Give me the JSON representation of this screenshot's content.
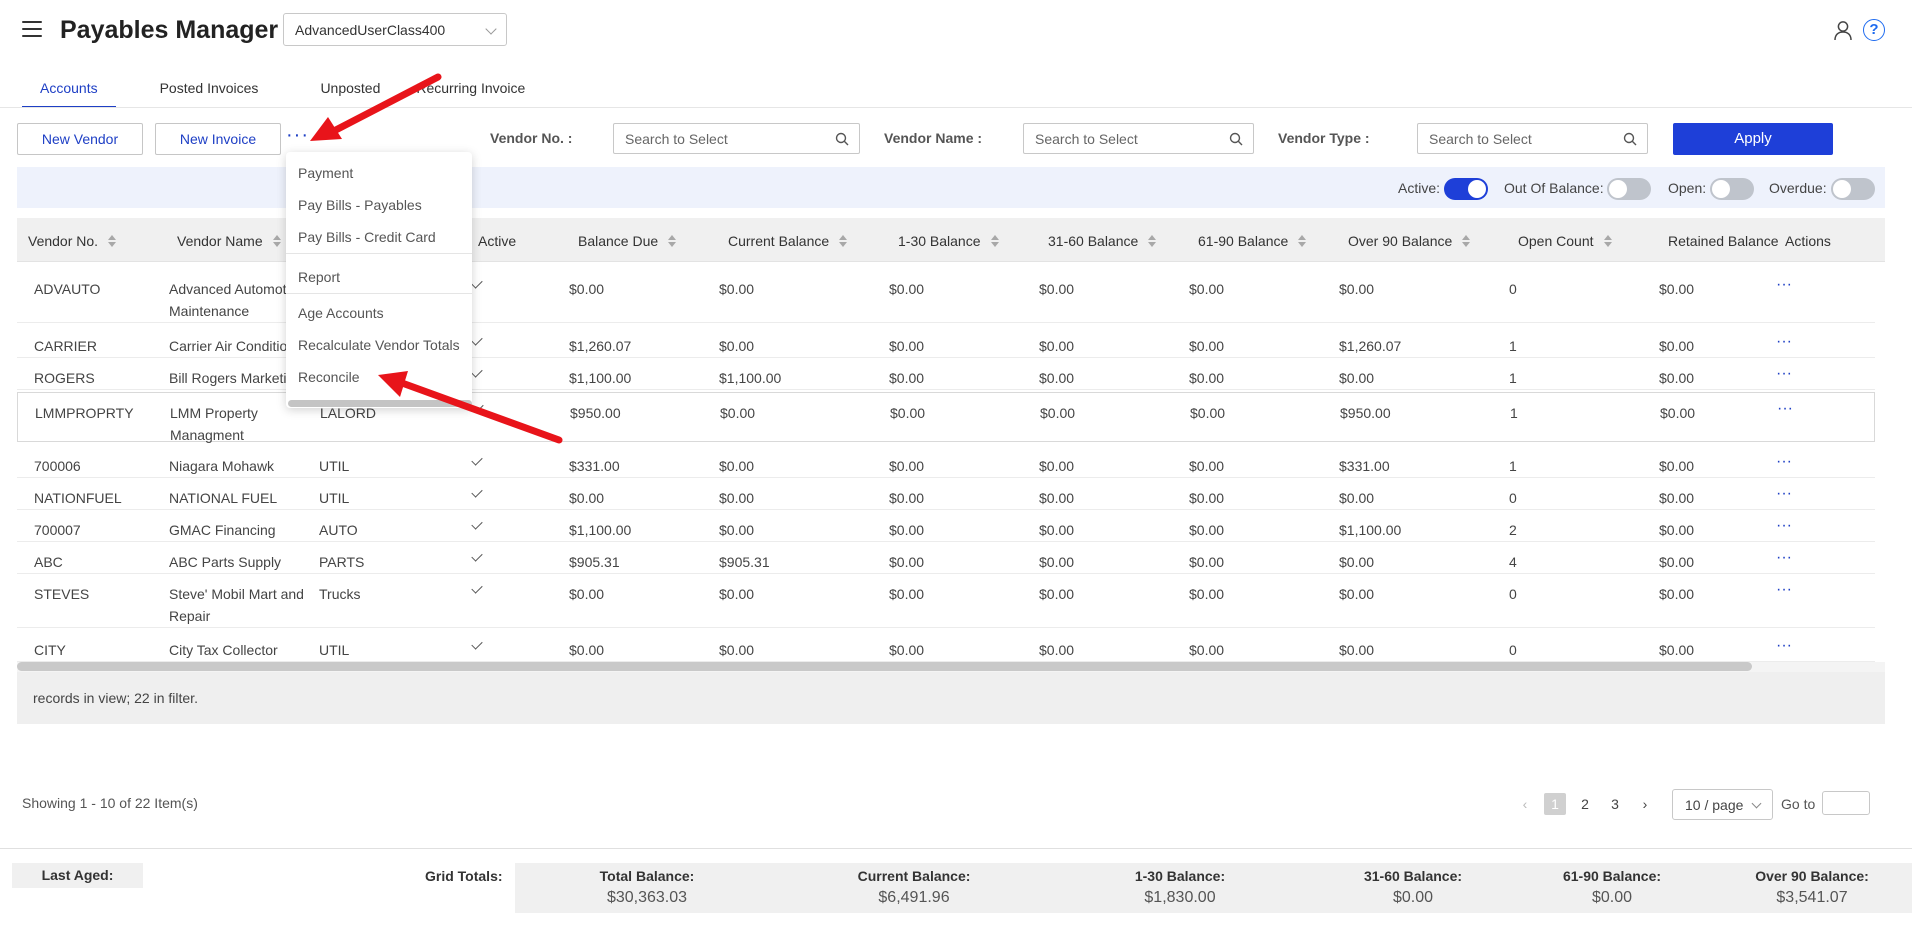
{
  "header": {
    "title": "Payables Manager",
    "class_select": "AdvancedUserClass400",
    "help_glyph": "?",
    "icons": {
      "menu": "hamburger-icon",
      "user": "user-icon",
      "help": "help-icon"
    }
  },
  "tabs": [
    {
      "label": "Accounts",
      "active": true
    },
    {
      "label": "Posted Invoices",
      "active": false
    },
    {
      "label": "Unposted",
      "active": false
    },
    {
      "label": "Recurring Invoice",
      "active": false
    }
  ],
  "toolbar": {
    "new_vendor": "New Vendor",
    "new_invoice": "New Invoice",
    "more": "···",
    "vendor_no_label": "Vendor No. :",
    "vendor_no_placeholder": "Search to Select",
    "vendor_name_label": "Vendor Name :",
    "vendor_name_placeholder": "Search to Select",
    "vendor_type_label": "Vendor Type :",
    "vendor_type_placeholder": "Search to Select",
    "apply": "Apply"
  },
  "toggles": [
    {
      "label": "Active:",
      "on": true
    },
    {
      "label": "Out Of Balance:",
      "on": false
    },
    {
      "label": "Open:",
      "on": false
    },
    {
      "label": "Overdue:",
      "on": false
    }
  ],
  "columns": [
    "Vendor No.",
    "Vendor Name",
    "Active",
    "Balance Due",
    "Current Balance",
    "1-30 Balance",
    "31-60 Balance",
    "61-90 Balance",
    "Over 90 Balance",
    "Open Count",
    "Retained Balance",
    "Actions"
  ],
  "rows": [
    {
      "no": "ADVAUTO",
      "name": "Advanced Automot",
      "name2": "Maintenance",
      "type": "",
      "active": true,
      "balance_due": "$0.00",
      "current": "$0.00",
      "b1_30": "$0.00",
      "b31_60": "$0.00",
      "b61_90": "$0.00",
      "over90": "$0.00",
      "open_count": "0",
      "retained": "$0.00",
      "action": "···"
    },
    {
      "no": "CARRIER",
      "name": "Carrier Air Conditio",
      "name2": "",
      "type": "",
      "active": true,
      "balance_due": "$1,260.07",
      "current": "$0.00",
      "b1_30": "$0.00",
      "b31_60": "$0.00",
      "b61_90": "$0.00",
      "over90": "$1,260.07",
      "open_count": "1",
      "retained": "$0.00",
      "action": "···"
    },
    {
      "no": "ROGERS",
      "name": "Bill Rogers Marketi",
      "name2": "",
      "type": "",
      "active": true,
      "balance_due": "$1,100.00",
      "current": "$1,100.00",
      "b1_30": "$0.00",
      "b31_60": "$0.00",
      "b61_90": "$0.00",
      "over90": "$0.00",
      "open_count": "1",
      "retained": "$0.00",
      "action": "···"
    },
    {
      "no": "LMMPROPRTY",
      "name": "LMM Property",
      "name2": "Managment",
      "type": "LALORD",
      "active": true,
      "balance_due": "$950.00",
      "current": "$0.00",
      "b1_30": "$0.00",
      "b31_60": "$0.00",
      "b61_90": "$0.00",
      "over90": "$950.00",
      "open_count": "1",
      "retained": "$0.00",
      "action": "···"
    },
    {
      "no": "700006",
      "name": "Niagara Mohawk",
      "name2": "",
      "type": "UTIL",
      "active": true,
      "balance_due": "$331.00",
      "current": "$0.00",
      "b1_30": "$0.00",
      "b31_60": "$0.00",
      "b61_90": "$0.00",
      "over90": "$331.00",
      "open_count": "1",
      "retained": "$0.00",
      "action": "···"
    },
    {
      "no": "NATIONFUEL",
      "name": "NATIONAL FUEL",
      "name2": "",
      "type": "UTIL",
      "active": true,
      "balance_due": "$0.00",
      "current": "$0.00",
      "b1_30": "$0.00",
      "b31_60": "$0.00",
      "b61_90": "$0.00",
      "over90": "$0.00",
      "open_count": "0",
      "retained": "$0.00",
      "action": "···"
    },
    {
      "no": "700007",
      "name": "GMAC Financing",
      "name2": "",
      "type": "AUTO",
      "active": true,
      "balance_due": "$1,100.00",
      "current": "$0.00",
      "b1_30": "$0.00",
      "b31_60": "$0.00",
      "b61_90": "$0.00",
      "over90": "$1,100.00",
      "open_count": "2",
      "retained": "$0.00",
      "action": "···"
    },
    {
      "no": "ABC",
      "name": "ABC Parts Supply",
      "name2": "",
      "type": "PARTS",
      "active": true,
      "balance_due": "$905.31",
      "current": "$905.31",
      "b1_30": "$0.00",
      "b31_60": "$0.00",
      "b61_90": "$0.00",
      "over90": "$0.00",
      "open_count": "4",
      "retained": "$0.00",
      "action": "···"
    },
    {
      "no": "STEVES",
      "name": "Steve' Mobil Mart and",
      "name2": "Repair",
      "type": "Trucks",
      "active": true,
      "balance_due": "$0.00",
      "current": "$0.00",
      "b1_30": "$0.00",
      "b31_60": "$0.00",
      "b61_90": "$0.00",
      "over90": "$0.00",
      "open_count": "0",
      "retained": "$0.00",
      "action": "···"
    },
    {
      "no": "CITY",
      "name": "City Tax Collector",
      "name2": "",
      "type": "UTIL",
      "active": true,
      "balance_due": "$0.00",
      "current": "$0.00",
      "b1_30": "$0.00",
      "b31_60": "$0.00",
      "b61_90": "$0.00",
      "over90": "$0.00",
      "open_count": "0",
      "retained": "$0.00",
      "action": "···"
    }
  ],
  "records_text": "records in view; 22 in filter.",
  "pagination": {
    "showing": "Showing 1 - 10 of 22 Item(s)",
    "prev": "‹",
    "pages": [
      "1",
      "2",
      "3"
    ],
    "current": "1",
    "next": "›",
    "page_size": "10 / page",
    "goto_label": "Go to"
  },
  "footer": {
    "last_aged_label": "Last Aged:",
    "grid_totals_label": "Grid Totals:",
    "totals": [
      {
        "label": "Total Balance:",
        "value": "$30,363.03"
      },
      {
        "label": "Current Balance:",
        "value": "$6,491.96"
      },
      {
        "label": "1-30 Balance:",
        "value": "$1,830.00"
      },
      {
        "label": "31-60 Balance:",
        "value": "$0.00"
      },
      {
        "label": "61-90 Balance:",
        "value": "$0.00"
      },
      {
        "label": "Over 90 Balance:",
        "value": "$3,541.07"
      }
    ]
  },
  "dropdown_menu": [
    "Payment",
    "Pay Bills - Payables",
    "Pay Bills - Credit Card",
    "Report",
    "Age Accounts",
    "Recalculate Vendor Totals",
    "Reconcile"
  ],
  "annotation_color": "#e8141a",
  "accent_color": "#1e3fd8"
}
